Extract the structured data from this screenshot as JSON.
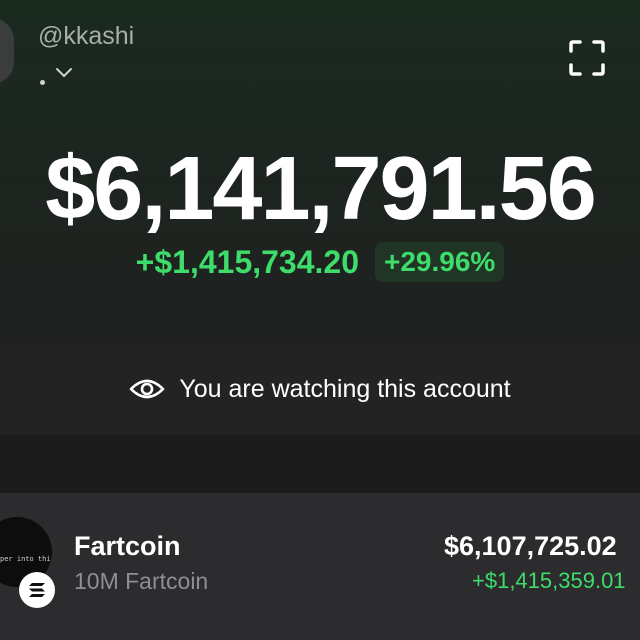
{
  "header": {
    "username": "@kkashi",
    "icons": {
      "account_switch": "chevron-down-icon",
      "expand": "expand-icon"
    }
  },
  "portfolio": {
    "balance": "$6,141,791.56",
    "change_amount": "+$1,415,734.20",
    "change_percent": "+29.96%"
  },
  "banner": {
    "text": "You are watching this account",
    "icon": "eye-icon"
  },
  "assets": [
    {
      "image_text": "per into this",
      "name": "Fartcoin",
      "quantity": "10M Fartcoin",
      "value": "$6,107,725.02",
      "change": "+$1,415,359.01",
      "chain_icon": "solana-icon"
    }
  ],
  "colors": {
    "positive": "#3ddc6b",
    "background": "#1c1c1e",
    "card": "#2c2c2e",
    "muted": "#8e8e93"
  }
}
